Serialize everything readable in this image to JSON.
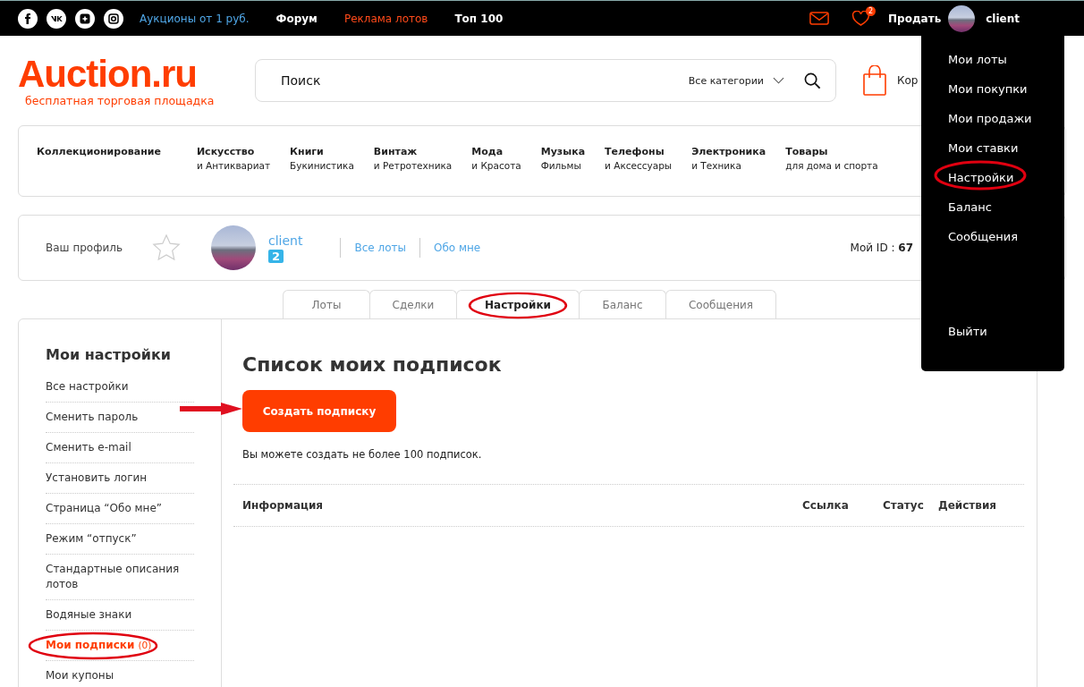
{
  "top_bar": {
    "links": [
      {
        "label": "Аукционы от 1 руб.",
        "kind": "accent"
      },
      {
        "label": "Форум",
        "kind": "plain"
      },
      {
        "label": "Реклама лотов",
        "kind": "promo"
      },
      {
        "label": "Топ 100",
        "kind": "plain"
      }
    ],
    "favorites_count": "2",
    "sell": "Продать",
    "username": "client"
  },
  "logo": {
    "name": "Auction.ru",
    "tagline": "бесплатная торговая площадка"
  },
  "search": {
    "placeholder": "Поиск",
    "category": "Все категории"
  },
  "cart": {
    "label": "Кор"
  },
  "categories": [
    {
      "title": "Коллекционирование"
    },
    {
      "title": "Искусство",
      "subtitle": "и Антиквариат"
    },
    {
      "title": "Книги",
      "subtitle": "Букинистика"
    },
    {
      "title": "Винтаж",
      "subtitle": "и Ретротехника"
    },
    {
      "title": "Мода",
      "subtitle": "и Красота"
    },
    {
      "title": "Музыка",
      "subtitle": "Фильмы"
    },
    {
      "title": "Телефоны",
      "subtitle": "и Аксессуары"
    },
    {
      "title": "Электроника",
      "subtitle": "и Техника"
    },
    {
      "title": "Товары",
      "subtitle": "для дома и спорта"
    }
  ],
  "profile": {
    "label": "Ваш профиль",
    "username": "client",
    "rating": "2",
    "links": [
      "Все лоты",
      "Обо мне"
    ],
    "id_label": "Мой ID :",
    "id_value": "67"
  },
  "tabs": [
    {
      "label": "Лоты",
      "selected": false,
      "highlighted": false
    },
    {
      "label": "Сделки",
      "selected": false,
      "highlighted": false
    },
    {
      "label": "Настройки",
      "selected": true,
      "highlighted": true
    },
    {
      "label": "Баланс",
      "selected": false,
      "highlighted": false
    },
    {
      "label": "Сообщения",
      "selected": false,
      "highlighted": false
    }
  ],
  "sidebar": {
    "title": "Мои настройки",
    "items": [
      {
        "label": "Все настройки",
        "selected": false,
        "highlighted": false
      },
      {
        "label": "Сменить пароль",
        "selected": false,
        "highlighted": false
      },
      {
        "label": "Сменить e-mail",
        "selected": false,
        "highlighted": false
      },
      {
        "label": "Установить логин",
        "selected": false,
        "highlighted": false
      },
      {
        "label": "Страница “Обо мне”",
        "selected": false,
        "highlighted": false
      },
      {
        "label": "Режим “отпуск”",
        "selected": false,
        "highlighted": false
      },
      {
        "label": "Стандартные описания лотов",
        "selected": false,
        "highlighted": false
      },
      {
        "label": "Водяные знаки",
        "selected": false,
        "highlighted": false
      },
      {
        "label": "Мои подписки",
        "count": "(0)",
        "selected": true,
        "highlighted": true
      },
      {
        "label": "Мои купоны",
        "selected": false,
        "highlighted": false
      }
    ]
  },
  "content": {
    "title": "Список моих подписок",
    "create_button": {
      "label": "Создать подписку",
      "arrow": true
    },
    "note": "Вы можете создать не более 100 подписок.",
    "table": {
      "columns": [
        "Информация",
        "Ссылка",
        "Статус",
        "Действия"
      ]
    }
  },
  "user_menu": {
    "items": [
      {
        "label": "Мои лоты",
        "highlighted": false
      },
      {
        "label": "Мои покупки",
        "highlighted": false
      },
      {
        "label": "Мои продажи",
        "highlighted": false
      },
      {
        "label": "Мои ставки",
        "highlighted": false
      },
      {
        "label": "Настройки",
        "highlighted": true
      },
      {
        "label": "Баланс",
        "highlighted": false
      },
      {
        "label": "Сообщения",
        "highlighted": false
      }
    ],
    "logout": "Выйти"
  }
}
